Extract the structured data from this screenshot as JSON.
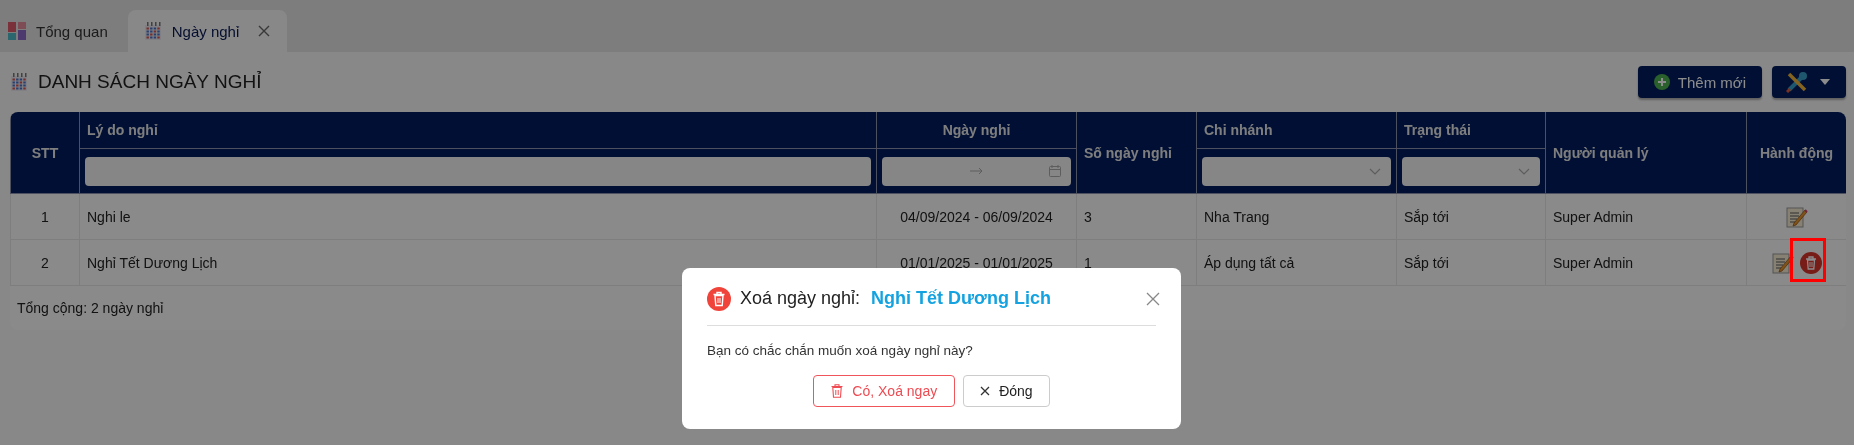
{
  "tabs": [
    {
      "label": "Tổng quan",
      "selected": false,
      "kind": "dashboard",
      "closable": false
    },
    {
      "label": "Ngày nghỉ",
      "selected": true,
      "kind": "calendar",
      "closable": true
    }
  ],
  "page": {
    "title": "DANH SÁCH NGÀY NGHỈ",
    "buttons": [
      {
        "kind": "add",
        "label": "Thêm mới"
      },
      {
        "kind": "tools"
      }
    ]
  },
  "table": {
    "columns": [
      {
        "label": "STT",
        "kind": "plain"
      },
      {
        "label": "Lý do nghỉ",
        "kind": "text"
      },
      {
        "label": "Ngày nghỉ",
        "kind": "daterange"
      },
      {
        "label": "Số ngày nghỉ",
        "kind": "plain"
      },
      {
        "label": "Chi nhánh",
        "kind": "select"
      },
      {
        "label": "Trạng thái",
        "kind": "select"
      },
      {
        "label": "Người quản lý",
        "kind": "plain"
      },
      {
        "label": "Hành động",
        "kind": "plain"
      }
    ],
    "rows": [
      {
        "cells": [
          "1",
          "Nghi le",
          "04/09/2024 - 06/09/2024",
          "3",
          "Nha Trang",
          "Sắp tới",
          "Super Admin"
        ],
        "actions": [
          {
            "kind": "edit",
            "highlighted": false
          }
        ]
      },
      {
        "cells": [
          "2",
          "Nghỉ Tết Dương Lịch",
          "01/01/2025 - 01/01/2025",
          "1",
          "Áp dụng tất cả",
          "Sắp tới",
          "Super Admin"
        ],
        "actions": [
          {
            "kind": "edit",
            "highlighted": false
          },
          {
            "kind": "delete",
            "highlighted": true
          }
        ]
      }
    ],
    "footer": "Tổng cộng: 2 ngày nghỉ"
  },
  "dialog": {
    "label": "Xoá ngày nghỉ:",
    "subject": "Nghỉ Tết Dương Lịch",
    "message": "Bạn có chắc chắn muốn xoá ngày nghỉ này?",
    "buttons": [
      {
        "kind": "danger",
        "label": "Có, Xoá ngay"
      },
      {
        "kind": "close",
        "label": "Đóng"
      }
    ]
  }
}
